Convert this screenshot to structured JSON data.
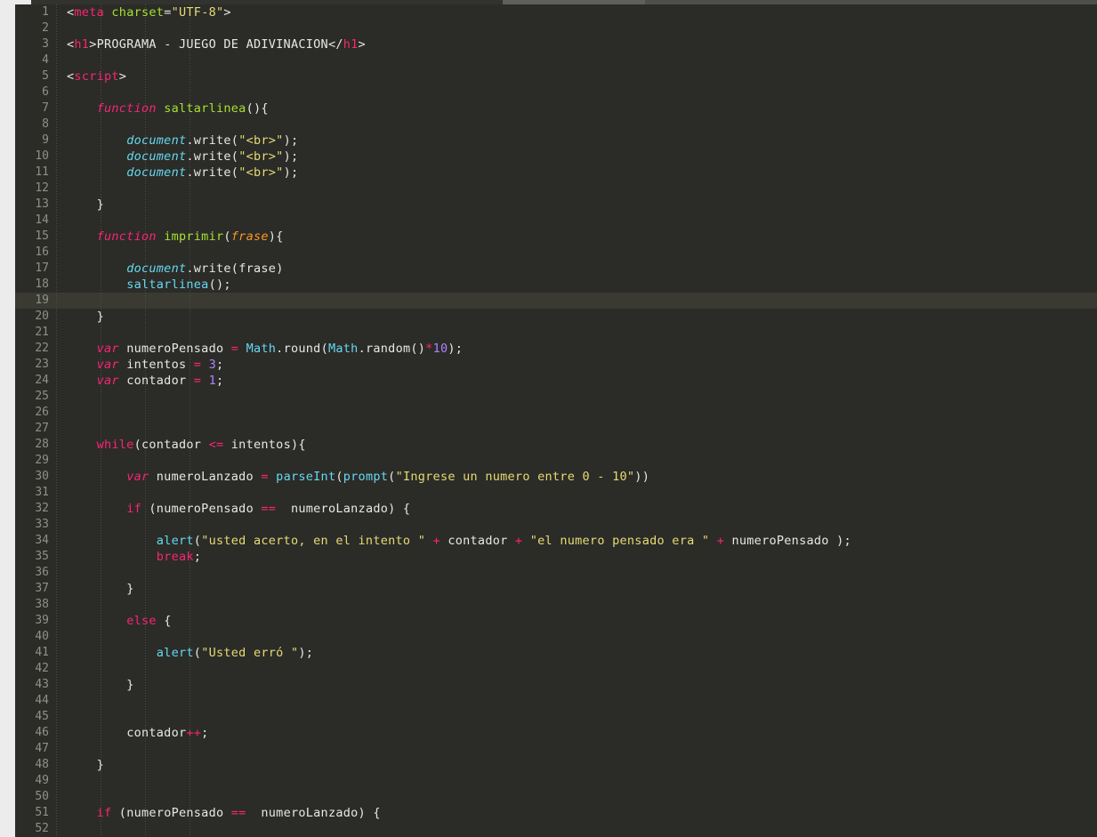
{
  "window": {
    "kind": "code-editor",
    "theme_name": "monokai-dark",
    "background": "#2b2b28",
    "gutter_text_color": "#8f9184",
    "active_line_background": "#3a3a33",
    "active_line_number": 19,
    "first_visible_line": 1,
    "last_visible_line": 52,
    "line_height_px": 18,
    "language": "html-javascript",
    "top_chrome": {
      "segments": [
        {
          "name": "left-light",
          "color": "#ececed"
        },
        {
          "name": "tab-inactive",
          "color": "#32322e"
        },
        {
          "name": "tab-active",
          "color": "#5f605c"
        },
        {
          "name": "tab-strip-right",
          "color": "#4e4f4b"
        }
      ]
    },
    "indent_guide_color": "#4e4f47",
    "indent_guide_x_positions": [
      46,
      96,
      146,
      196
    ]
  },
  "palette": {
    "plain": "#e8e8e3",
    "keyword": "#f92672",
    "function_name": "#a6e22e",
    "builtin": "#66d9ef",
    "parameter": "#fd971f",
    "string": "#e6db74",
    "number": "#ae81ff",
    "operator": "#f92672"
  },
  "code": {
    "lines": [
      {
        "n": 1,
        "text": "<meta charset=\"UTF-8\">"
      },
      {
        "n": 2,
        "text": ""
      },
      {
        "n": 3,
        "text": "<h1>PROGRAMA - JUEGO DE ADIVINACION</h1>"
      },
      {
        "n": 4,
        "text": ""
      },
      {
        "n": 5,
        "text": "<script>"
      },
      {
        "n": 6,
        "text": ""
      },
      {
        "n": 7,
        "text": "    function saltarlinea(){"
      },
      {
        "n": 8,
        "text": ""
      },
      {
        "n": 9,
        "text": "        document.write(\"<br>\");"
      },
      {
        "n": 10,
        "text": "        document.write(\"<br>\");"
      },
      {
        "n": 11,
        "text": "        document.write(\"<br>\");"
      },
      {
        "n": 12,
        "text": ""
      },
      {
        "n": 13,
        "text": "    }"
      },
      {
        "n": 14,
        "text": ""
      },
      {
        "n": 15,
        "text": "    function imprimir(frase){"
      },
      {
        "n": 16,
        "text": ""
      },
      {
        "n": 17,
        "text": "        document.write(frase)"
      },
      {
        "n": 18,
        "text": "        saltarlinea();"
      },
      {
        "n": 19,
        "text": ""
      },
      {
        "n": 20,
        "text": "    }"
      },
      {
        "n": 21,
        "text": ""
      },
      {
        "n": 22,
        "text": "    var numeroPensado = Math.round(Math.random()*10);"
      },
      {
        "n": 23,
        "text": "    var intentos = 3;"
      },
      {
        "n": 24,
        "text": "    var contador = 1;"
      },
      {
        "n": 25,
        "text": ""
      },
      {
        "n": 26,
        "text": ""
      },
      {
        "n": 27,
        "text": ""
      },
      {
        "n": 28,
        "text": "    while(contador <= intentos){"
      },
      {
        "n": 29,
        "text": ""
      },
      {
        "n": 30,
        "text": "        var numeroLanzado = parseInt(prompt(\"Ingrese un numero entre 0 - 10\"))"
      },
      {
        "n": 31,
        "text": ""
      },
      {
        "n": 32,
        "text": "        if (numeroPensado ==  numeroLanzado) {"
      },
      {
        "n": 33,
        "text": ""
      },
      {
        "n": 34,
        "text": "            alert(\"usted acerto, en el intento \" + contador + \"el numero pensado era \" + numeroPensado );"
      },
      {
        "n": 35,
        "text": "            break;"
      },
      {
        "n": 36,
        "text": ""
      },
      {
        "n": 37,
        "text": "        }"
      },
      {
        "n": 38,
        "text": ""
      },
      {
        "n": 39,
        "text": "        else {"
      },
      {
        "n": 40,
        "text": ""
      },
      {
        "n": 41,
        "text": "            alert(\"Usted erró \");"
      },
      {
        "n": 42,
        "text": ""
      },
      {
        "n": 43,
        "text": "        }"
      },
      {
        "n": 44,
        "text": ""
      },
      {
        "n": 45,
        "text": ""
      },
      {
        "n": 46,
        "text": "        contador++;"
      },
      {
        "n": 47,
        "text": ""
      },
      {
        "n": 48,
        "text": "    }"
      },
      {
        "n": 49,
        "text": ""
      },
      {
        "n": 50,
        "text": ""
      },
      {
        "n": 51,
        "text": "    if (numeroPensado ==  numeroLanzado) {"
      },
      {
        "n": 52,
        "text": ""
      }
    ],
    "tokens": {
      "1": [
        [
          "t-punc",
          "<"
        ],
        [
          "t-tag",
          "meta"
        ],
        [
          "t-plain",
          " "
        ],
        [
          "t-attr",
          "charset"
        ],
        [
          "t-punc",
          "="
        ],
        [
          "t-str",
          "\"UTF-8\""
        ],
        [
          "t-punc",
          ">"
        ]
      ],
      "3": [
        [
          "t-punc",
          "<"
        ],
        [
          "t-tag",
          "h1"
        ],
        [
          "t-punc",
          ">"
        ],
        [
          "t-plain",
          "PROGRAMA - JUEGO DE ADIVINACION"
        ],
        [
          "t-punc",
          "</"
        ],
        [
          "t-tag",
          "h1"
        ],
        [
          "t-punc",
          ">"
        ]
      ],
      "5": [
        [
          "t-punc",
          "<"
        ],
        [
          "t-tag",
          "script"
        ],
        [
          "t-punc",
          ">"
        ]
      ],
      "7": [
        [
          "t-plain",
          "    "
        ],
        [
          "t-kw t-italic",
          "function"
        ],
        [
          "t-plain",
          " "
        ],
        [
          "t-func",
          "saltarlinea"
        ],
        [
          "t-punc",
          "(){"
        ]
      ],
      "9": [
        [
          "t-plain",
          "        "
        ],
        [
          "t-builtin t-italic",
          "document"
        ],
        [
          "t-punc",
          "."
        ],
        [
          "t-plain",
          "write"
        ],
        [
          "t-punc",
          "("
        ],
        [
          "t-str",
          "\"<br>\""
        ],
        [
          "t-punc",
          ");"
        ]
      ],
      "10": [
        [
          "t-plain",
          "        "
        ],
        [
          "t-builtin t-italic",
          "document"
        ],
        [
          "t-punc",
          "."
        ],
        [
          "t-plain",
          "write"
        ],
        [
          "t-punc",
          "("
        ],
        [
          "t-str",
          "\"<br>\""
        ],
        [
          "t-punc",
          ");"
        ]
      ],
      "11": [
        [
          "t-plain",
          "        "
        ],
        [
          "t-builtin t-italic",
          "document"
        ],
        [
          "t-punc",
          "."
        ],
        [
          "t-plain",
          "write"
        ],
        [
          "t-punc",
          "("
        ],
        [
          "t-str",
          "\"<br>\""
        ],
        [
          "t-punc",
          ");"
        ]
      ],
      "13": [
        [
          "t-plain",
          "    "
        ],
        [
          "t-punc",
          "}"
        ]
      ],
      "15": [
        [
          "t-plain",
          "    "
        ],
        [
          "t-kw t-italic",
          "function"
        ],
        [
          "t-plain",
          " "
        ],
        [
          "t-func",
          "imprimir"
        ],
        [
          "t-punc",
          "("
        ],
        [
          "t-param",
          "frase"
        ],
        [
          "t-punc",
          "){"
        ]
      ],
      "17": [
        [
          "t-plain",
          "        "
        ],
        [
          "t-builtin t-italic",
          "document"
        ],
        [
          "t-punc",
          "."
        ],
        [
          "t-plain",
          "write"
        ],
        [
          "t-punc",
          "("
        ],
        [
          "t-plain",
          "frase"
        ],
        [
          "t-punc",
          ")"
        ]
      ],
      "18": [
        [
          "t-plain",
          "        "
        ],
        [
          "t-builtin",
          "saltarlinea"
        ],
        [
          "t-punc",
          "();"
        ]
      ],
      "20": [
        [
          "t-plain",
          "    "
        ],
        [
          "t-punc",
          "}"
        ]
      ],
      "22": [
        [
          "t-plain",
          "    "
        ],
        [
          "t-kw t-italic",
          "var"
        ],
        [
          "t-plain",
          " numeroPensado "
        ],
        [
          "t-op",
          "="
        ],
        [
          "t-plain",
          " "
        ],
        [
          "t-builtin",
          "Math"
        ],
        [
          "t-punc",
          "."
        ],
        [
          "t-plain",
          "round"
        ],
        [
          "t-punc",
          "("
        ],
        [
          "t-builtin",
          "Math"
        ],
        [
          "t-punc",
          "."
        ],
        [
          "t-plain",
          "random"
        ],
        [
          "t-punc",
          "()"
        ],
        [
          "t-op",
          "*"
        ],
        [
          "t-num",
          "10"
        ],
        [
          "t-punc",
          ");"
        ]
      ],
      "23": [
        [
          "t-plain",
          "    "
        ],
        [
          "t-kw t-italic",
          "var"
        ],
        [
          "t-plain",
          " intentos "
        ],
        [
          "t-op",
          "="
        ],
        [
          "t-plain",
          " "
        ],
        [
          "t-num",
          "3"
        ],
        [
          "t-punc",
          ";"
        ]
      ],
      "24": [
        [
          "t-plain",
          "    "
        ],
        [
          "t-kw t-italic",
          "var"
        ],
        [
          "t-plain",
          " contador "
        ],
        [
          "t-op",
          "="
        ],
        [
          "t-plain",
          " "
        ],
        [
          "t-num",
          "1"
        ],
        [
          "t-punc",
          ";"
        ]
      ],
      "28": [
        [
          "t-plain",
          "    "
        ],
        [
          "t-kw",
          "while"
        ],
        [
          "t-punc",
          "("
        ],
        [
          "t-plain",
          "contador "
        ],
        [
          "t-op",
          "<="
        ],
        [
          "t-plain",
          " intentos"
        ],
        [
          "t-punc",
          "){"
        ]
      ],
      "30": [
        [
          "t-plain",
          "        "
        ],
        [
          "t-kw t-italic",
          "var"
        ],
        [
          "t-plain",
          " numeroLanzado "
        ],
        [
          "t-op",
          "="
        ],
        [
          "t-plain",
          " "
        ],
        [
          "t-builtin",
          "parseInt"
        ],
        [
          "t-punc",
          "("
        ],
        [
          "t-builtin",
          "prompt"
        ],
        [
          "t-punc",
          "("
        ],
        [
          "t-str",
          "\"Ingrese un numero entre 0 - 10\""
        ],
        [
          "t-punc",
          "))"
        ]
      ],
      "32": [
        [
          "t-plain",
          "        "
        ],
        [
          "t-kw",
          "if"
        ],
        [
          "t-plain",
          " "
        ],
        [
          "t-punc",
          "("
        ],
        [
          "t-plain",
          "numeroPensado "
        ],
        [
          "t-op",
          "=="
        ],
        [
          "t-plain",
          "  numeroLanzado"
        ],
        [
          "t-punc",
          ") {"
        ]
      ],
      "34": [
        [
          "t-plain",
          "            "
        ],
        [
          "t-builtin",
          "alert"
        ],
        [
          "t-punc",
          "("
        ],
        [
          "t-str",
          "\"usted acerto, en el intento \""
        ],
        [
          "t-plain",
          " "
        ],
        [
          "t-op",
          "+"
        ],
        [
          "t-plain",
          " contador "
        ],
        [
          "t-op",
          "+"
        ],
        [
          "t-plain",
          " "
        ],
        [
          "t-str",
          "\"el numero pensado era \""
        ],
        [
          "t-plain",
          " "
        ],
        [
          "t-op",
          "+"
        ],
        [
          "t-plain",
          " numeroPensado "
        ],
        [
          "t-punc",
          ");"
        ]
      ],
      "35": [
        [
          "t-plain",
          "            "
        ],
        [
          "t-kw",
          "break"
        ],
        [
          "t-punc",
          ";"
        ]
      ],
      "37": [
        [
          "t-plain",
          "        "
        ],
        [
          "t-punc",
          "}"
        ]
      ],
      "39": [
        [
          "t-plain",
          "        "
        ],
        [
          "t-kw",
          "else"
        ],
        [
          "t-plain",
          " "
        ],
        [
          "t-punc",
          "{"
        ]
      ],
      "41": [
        [
          "t-plain",
          "            "
        ],
        [
          "t-builtin",
          "alert"
        ],
        [
          "t-punc",
          "("
        ],
        [
          "t-str",
          "\"Usted erró \""
        ],
        [
          "t-punc",
          ");"
        ]
      ],
      "43": [
        [
          "t-plain",
          "        "
        ],
        [
          "t-punc",
          "}"
        ]
      ],
      "46": [
        [
          "t-plain",
          "        "
        ],
        [
          "t-plain",
          "contador"
        ],
        [
          "t-op",
          "++"
        ],
        [
          "t-punc",
          ";"
        ]
      ],
      "48": [
        [
          "t-plain",
          "    "
        ],
        [
          "t-punc",
          "}"
        ]
      ],
      "51": [
        [
          "t-plain",
          "    "
        ],
        [
          "t-kw",
          "if"
        ],
        [
          "t-plain",
          " "
        ],
        [
          "t-punc",
          "("
        ],
        [
          "t-plain",
          "numeroPensado "
        ],
        [
          "t-op",
          "=="
        ],
        [
          "t-plain",
          "  numeroLanzado"
        ],
        [
          "t-punc",
          ") {"
        ]
      ]
    }
  }
}
